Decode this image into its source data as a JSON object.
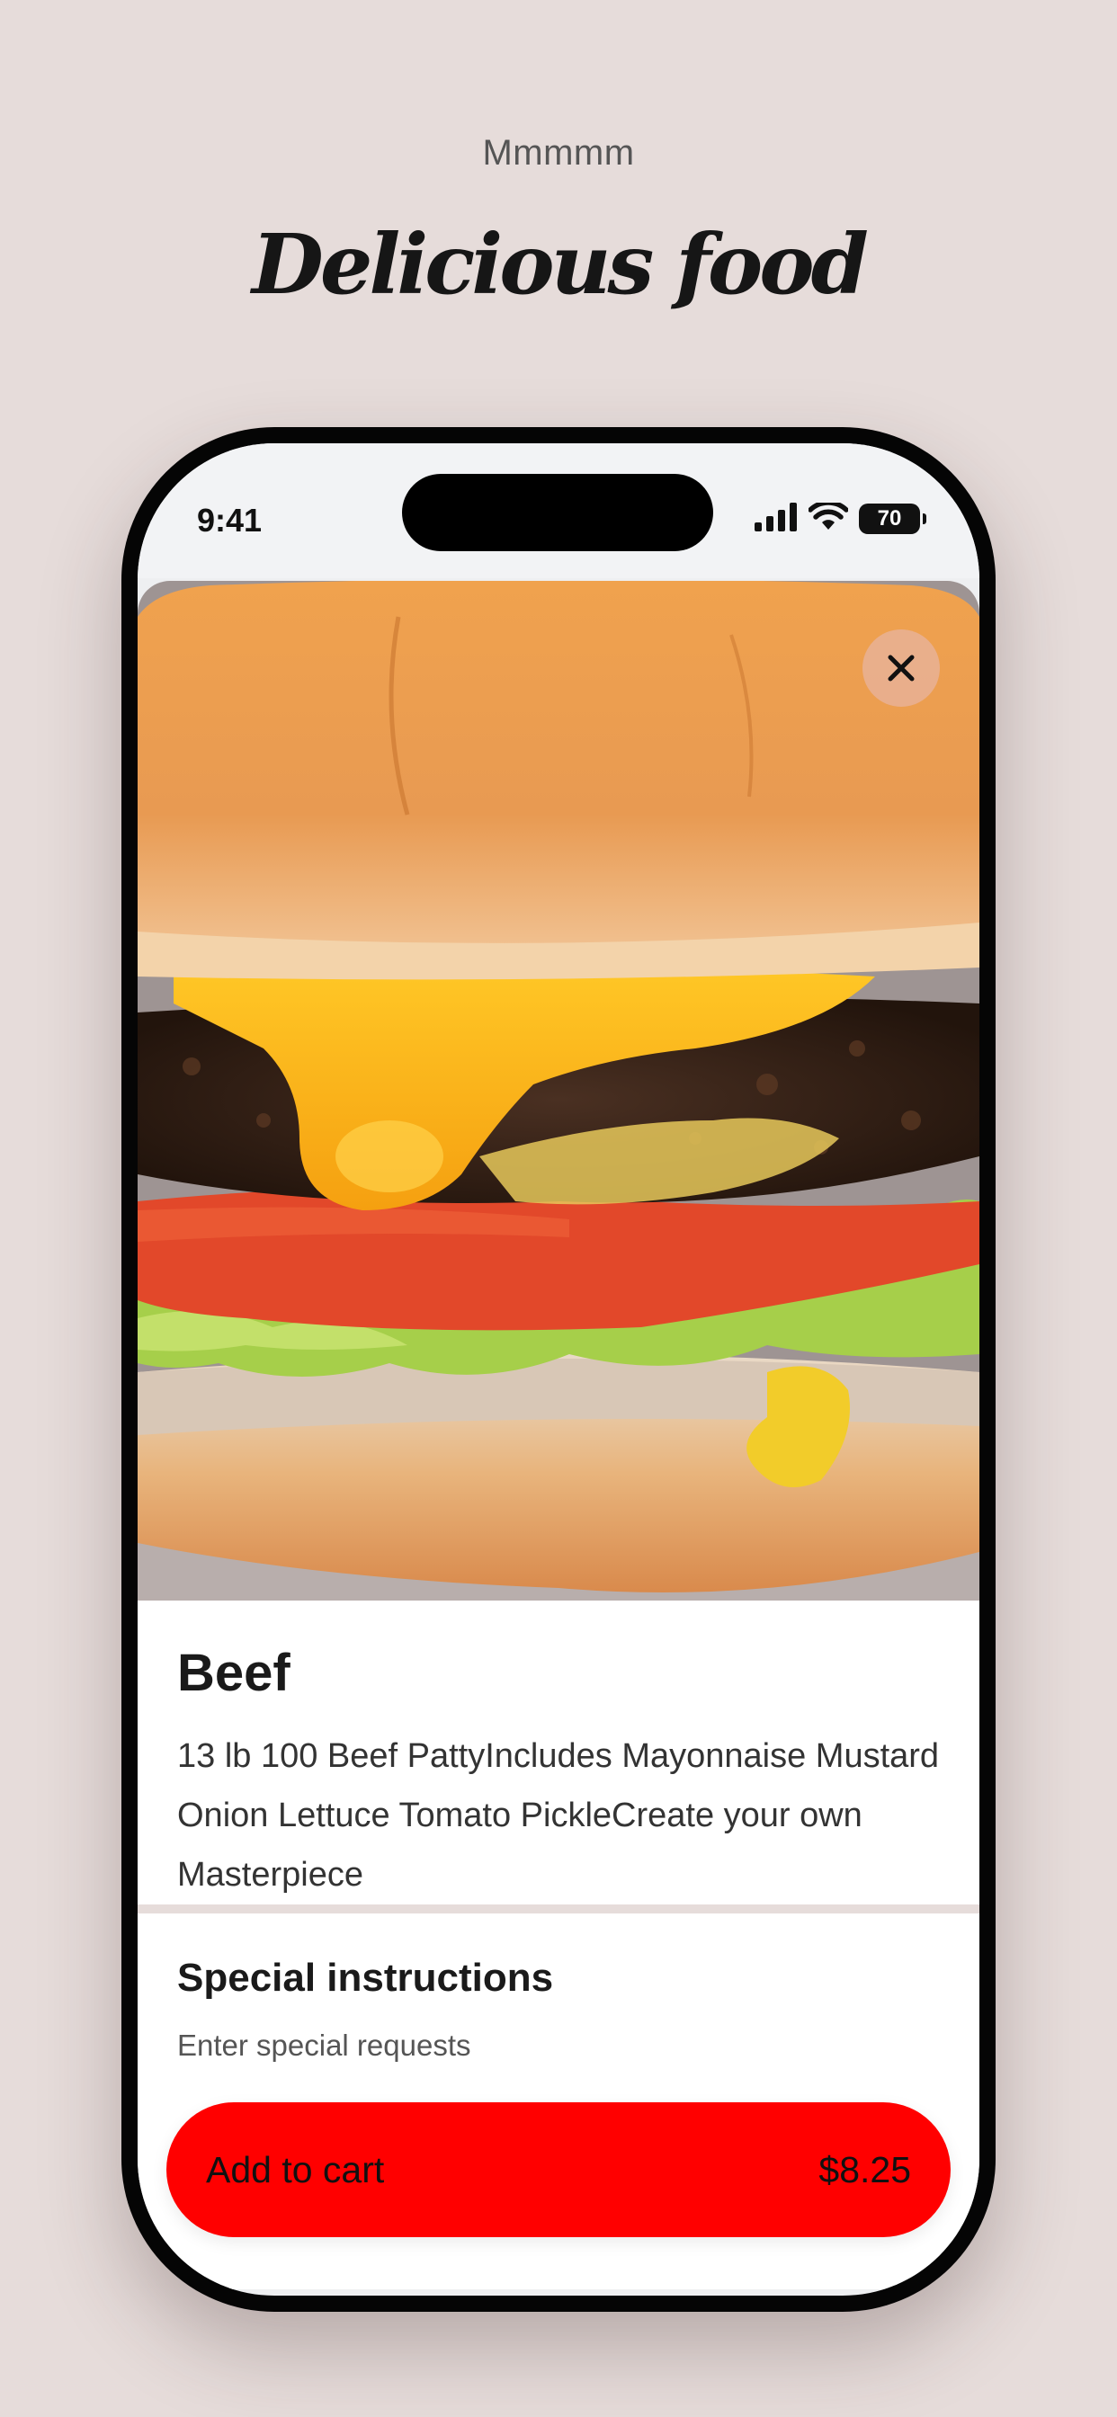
{
  "header": {
    "eyebrow": "Mmmmm",
    "title": "Delicious food"
  },
  "status_bar": {
    "time": "9:41",
    "battery": "70",
    "icons": [
      "signal-icon",
      "wifi-icon",
      "battery-icon"
    ]
  },
  "product": {
    "image": "burger-photo",
    "name": "Beef",
    "description": "13 lb 100 Beef PattyIncludes Mayonnaise Mustard Onion Lettuce Tomato PickleCreate your own Masterpiece"
  },
  "special_instructions": {
    "title": "Special instructions",
    "placeholder": "Enter special requests",
    "value": ""
  },
  "cart": {
    "label": "Add to cart",
    "price": "$8.25"
  },
  "colors": {
    "background": "#e6dcda",
    "accent": "#ff0000",
    "close_button": "#e8b090"
  }
}
